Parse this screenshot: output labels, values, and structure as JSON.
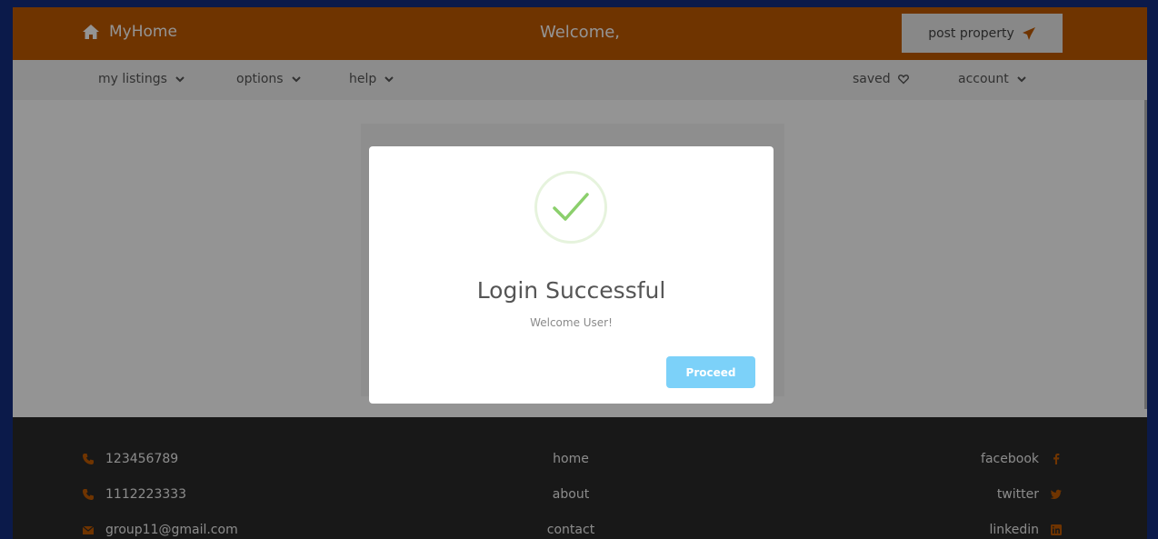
{
  "header": {
    "brand": "MyHome",
    "welcome": "Welcome,",
    "post_property": "post property"
  },
  "nav": {
    "my_listings": "my listings",
    "options": "options",
    "help": "help",
    "saved": "saved",
    "account": "account"
  },
  "footer": {
    "phone1": "123456789",
    "phone2": "1112223333",
    "email": "group11@gmail.com",
    "home": "home",
    "about": "about",
    "contact": "contact",
    "facebook": "facebook",
    "twitter": "twitter",
    "linkedin": "linkedin"
  },
  "modal": {
    "title": "Login Successful",
    "text": "Welcome User!",
    "button": "Proceed"
  },
  "colors": {
    "brand_orange": "#c05a00",
    "footer_bg": "#2a2a2a",
    "success_green": "#8bcf6c",
    "proceed_blue": "#7cd1f9"
  },
  "icons": {
    "brand": "home-icon",
    "post": "paper-plane-icon",
    "dropdown": "chevron-down-icon",
    "saved": "heart-icon",
    "phone": "phone-icon",
    "email": "envelope-icon",
    "facebook": "facebook-icon",
    "twitter": "twitter-icon",
    "linkedin": "linkedin-icon",
    "success": "check-icon"
  }
}
